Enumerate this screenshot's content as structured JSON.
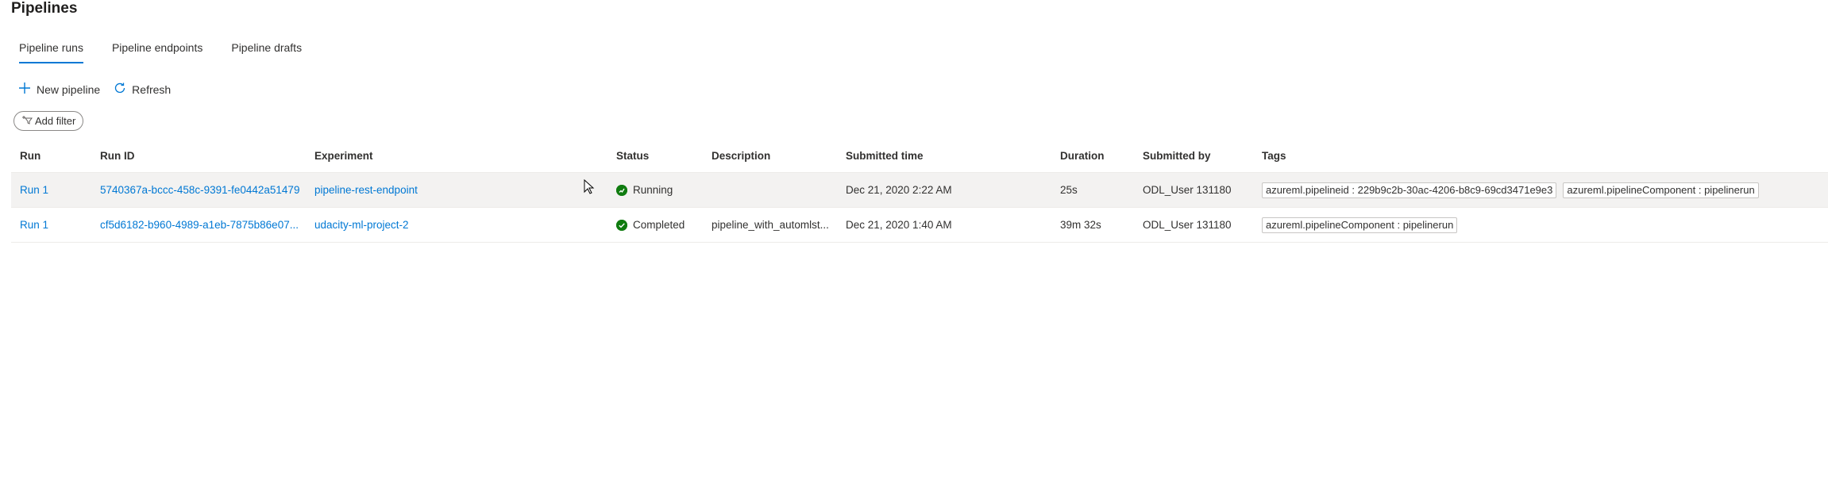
{
  "page": {
    "title": "Pipelines"
  },
  "tabs": [
    {
      "label": "Pipeline runs",
      "active": true
    },
    {
      "label": "Pipeline endpoints",
      "active": false
    },
    {
      "label": "Pipeline drafts",
      "active": false
    }
  ],
  "toolbar": {
    "new_pipeline_label": "New pipeline",
    "new_pipeline_icon": "plus-icon",
    "refresh_label": "Refresh",
    "refresh_icon": "refresh-icon"
  },
  "filter": {
    "add_filter_label": "Add filter",
    "icon": "filter-add-icon"
  },
  "table": {
    "columns": {
      "run": "Run",
      "run_id": "Run ID",
      "experiment": "Experiment",
      "status": "Status",
      "description": "Description",
      "submitted_time": "Submitted time",
      "duration": "Duration",
      "submitted_by": "Submitted by",
      "tags": "Tags"
    },
    "rows": [
      {
        "run": "Run 1",
        "run_id": "5740367a-bccc-458c-9391-fe0442a51479",
        "experiment": "pipeline-rest-endpoint",
        "status": "Running",
        "status_icon": "running-icon",
        "description": "",
        "submitted_time": "Dec 21, 2020 2:22 AM",
        "duration": "25s",
        "submitted_by": "ODL_User 131180",
        "tags": [
          "azureml.pipelineid : 229b9c2b-30ac-4206-b8c9-69cd3471e9e3",
          "azureml.pipelineComponent : pipelinerun"
        ]
      },
      {
        "run": "Run 1",
        "run_id": "cf5d6182-b960-4989-a1eb-7875b86e07...",
        "experiment": "udacity-ml-project-2",
        "status": "Completed",
        "status_icon": "check-circle-icon",
        "description": "pipeline_with_automlst...",
        "submitted_time": "Dec 21, 2020 1:40 AM",
        "duration": "39m 32s",
        "submitted_by": "ODL_User 131180",
        "tags": [
          "azureml.pipelineComponent : pipelinerun"
        ]
      }
    ]
  },
  "colors": {
    "accent": "#0078d4",
    "status_green": "#107c10"
  }
}
